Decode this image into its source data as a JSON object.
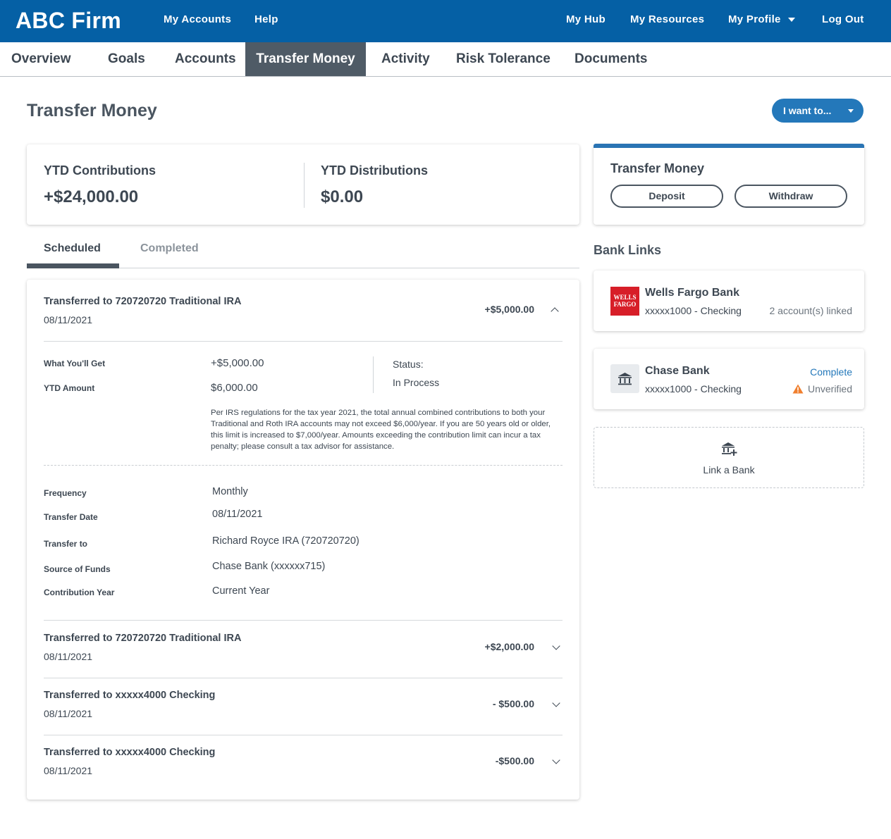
{
  "header": {
    "brand": "ABC Firm",
    "left_nav": [
      "My Accounts",
      "Help"
    ],
    "right_nav": [
      "My Hub",
      "My Resources",
      "My Profile",
      "Log Out"
    ],
    "bg_color": "#0560a5"
  },
  "tabs": [
    "Overview",
    "Goals",
    "Accounts",
    "Transfer Money",
    "Activity",
    "Risk Tolerance",
    "Documents"
  ],
  "active_tab": "Transfer Money",
  "page": {
    "title": "Transfer Money",
    "action_button": "I want to..."
  },
  "ytd": {
    "contributions_label": "YTD Contributions",
    "contributions_value": "+$24,000.00",
    "distributions_label": "YTD Distributions",
    "distributions_value": "$0.00"
  },
  "transfer_card": {
    "title": "Transfer Money",
    "deposit_label": "Deposit",
    "withdraw_label": "Withdraw"
  },
  "subtabs": {
    "scheduled": "Scheduled",
    "completed": "Completed",
    "active": "Scheduled"
  },
  "expanded": {
    "title": "Transferred to 720720720 Traditional IRA",
    "date": "08/11/2021",
    "amount": "+$5,000.00",
    "what_youll_get_label": "What You'll Get",
    "what_youll_get_value": "+$5,000.00",
    "ytd_amount_label": "YTD Amount",
    "ytd_amount_value": "$6,000.00",
    "status_label": "Status:",
    "status_value": "In Process",
    "note": "Per IRS regulations for the tax year 2021, the total annual combined contributions to both your Traditional and Roth IRA accounts may not exceed $6,000/year. If you are 50 years old or older, this limit is increased to $7,000/year. Amounts exceeding the contribution limit can incur a tax penalty; please consult a tax advisor for assistance.",
    "details": [
      {
        "label": "Frequency",
        "value": "Monthly"
      },
      {
        "label": "Transfer Date",
        "value": "08/11/2021"
      },
      {
        "label": "Transfer to",
        "value": "Richard Royce IRA (720720720)"
      },
      {
        "label": "Source of Funds",
        "value": "Chase Bank (xxxxxx715)"
      },
      {
        "label": "Contribution Year",
        "value": "Current Year"
      }
    ]
  },
  "transfers": [
    {
      "title": "Transferred to 720720720 Traditional IRA",
      "date": "08/11/2021",
      "amount": "+$2,000.00"
    },
    {
      "title": "Transferred to xxxxx4000 Checking",
      "date": "08/11/2021",
      "amount": "- $500.00"
    },
    {
      "title": "Transferred to xxxxx4000 Checking",
      "date": "08/11/2021",
      "amount": "-$500.00"
    }
  ],
  "bank_links": {
    "title": "Bank Links",
    "banks": [
      {
        "name": "Wells Fargo Bank",
        "account": "xxxxx1000 - Checking",
        "logo_text": "WELLS FARGO",
        "right_bottom": "2 account(s) linked",
        "logo_color": "#d71e28"
      },
      {
        "name": "Chase Bank",
        "account": "xxxxx1000 - Checking",
        "right_top": "Complete",
        "right_bottom": "Unverified",
        "accent_color": "#2478ba",
        "warning_color": "#f07f2e"
      }
    ],
    "link_label": "Link a Bank"
  }
}
